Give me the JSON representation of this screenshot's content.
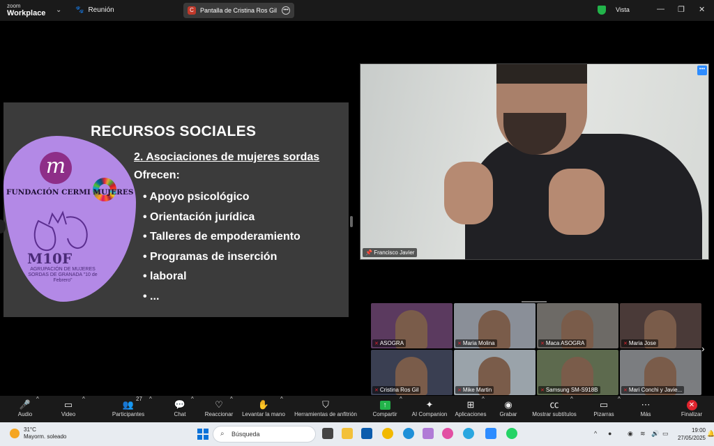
{
  "titlebar": {
    "brand_top": "zoom",
    "brand_bottom": "Workplace",
    "meeting_label": "Reunión",
    "share_initial": "C",
    "share_label": "Pantalla de Cristina Ros Gil",
    "view_label": "Vista"
  },
  "slide": {
    "title": "RECURSOS SOCIALES",
    "subtitle": "2. Asociaciones de mujeres sordas",
    "offer": "Ofrecen:",
    "bullets": [
      "Apoyo psicológico",
      "Orientación jurídica",
      "Talleres de empoderamiento",
      "Programas de inserción",
      "laboral",
      "..."
    ],
    "logo_letter": "m",
    "org_name": "FUNDACIÓN CERMI MUJERES",
    "m10f_title": "M10F",
    "m10f_caption": "AGRUPACIÓN DE MUJERES SORDAS DE GRANADA \"10 de Febrero\""
  },
  "speaker": {
    "name": "Francisco Javier"
  },
  "gallery": [
    {
      "name": "ASOGRA",
      "bg": "#5b3a5f"
    },
    {
      "name": "Maria Molina",
      "bg": "#8a8f98"
    },
    {
      "name": "Maca ASOGRA",
      "bg": "#6d6a66"
    },
    {
      "name": "Maria Jose",
      "bg": "#4a3a38"
    },
    {
      "name": "Cristina Ros Gil",
      "bg": "#3a3f52"
    },
    {
      "name": "Mike Martin",
      "bg": "#9aa3aa"
    },
    {
      "name": "Samsung SM-S918B",
      "bg": "#5d6a4e"
    },
    {
      "name": "Mari Conchi y Javie...",
      "bg": "#7b7d80"
    }
  ],
  "toolbar": {
    "audio": "Audio",
    "video": "Video",
    "participants": "Participantes",
    "participants_count": "27",
    "chat": "Chat",
    "react": "Reaccionar",
    "raise_hand": "Levantar la mano",
    "host_tools": "Herramientas de anfitrión",
    "share": "Compartir",
    "ai_companion": "AI Companion",
    "apps": "Aplicaciones",
    "record": "Grabar",
    "captions": "Mostrar subtítulos",
    "whiteboards": "Pizarras",
    "more": "Más",
    "end": "Finalizar"
  },
  "taskbar": {
    "temp": "31°C",
    "weather": "Mayorm. soleado",
    "search_placeholder": "Búsqueda",
    "time": "19:00",
    "date": "27/05/2025"
  }
}
